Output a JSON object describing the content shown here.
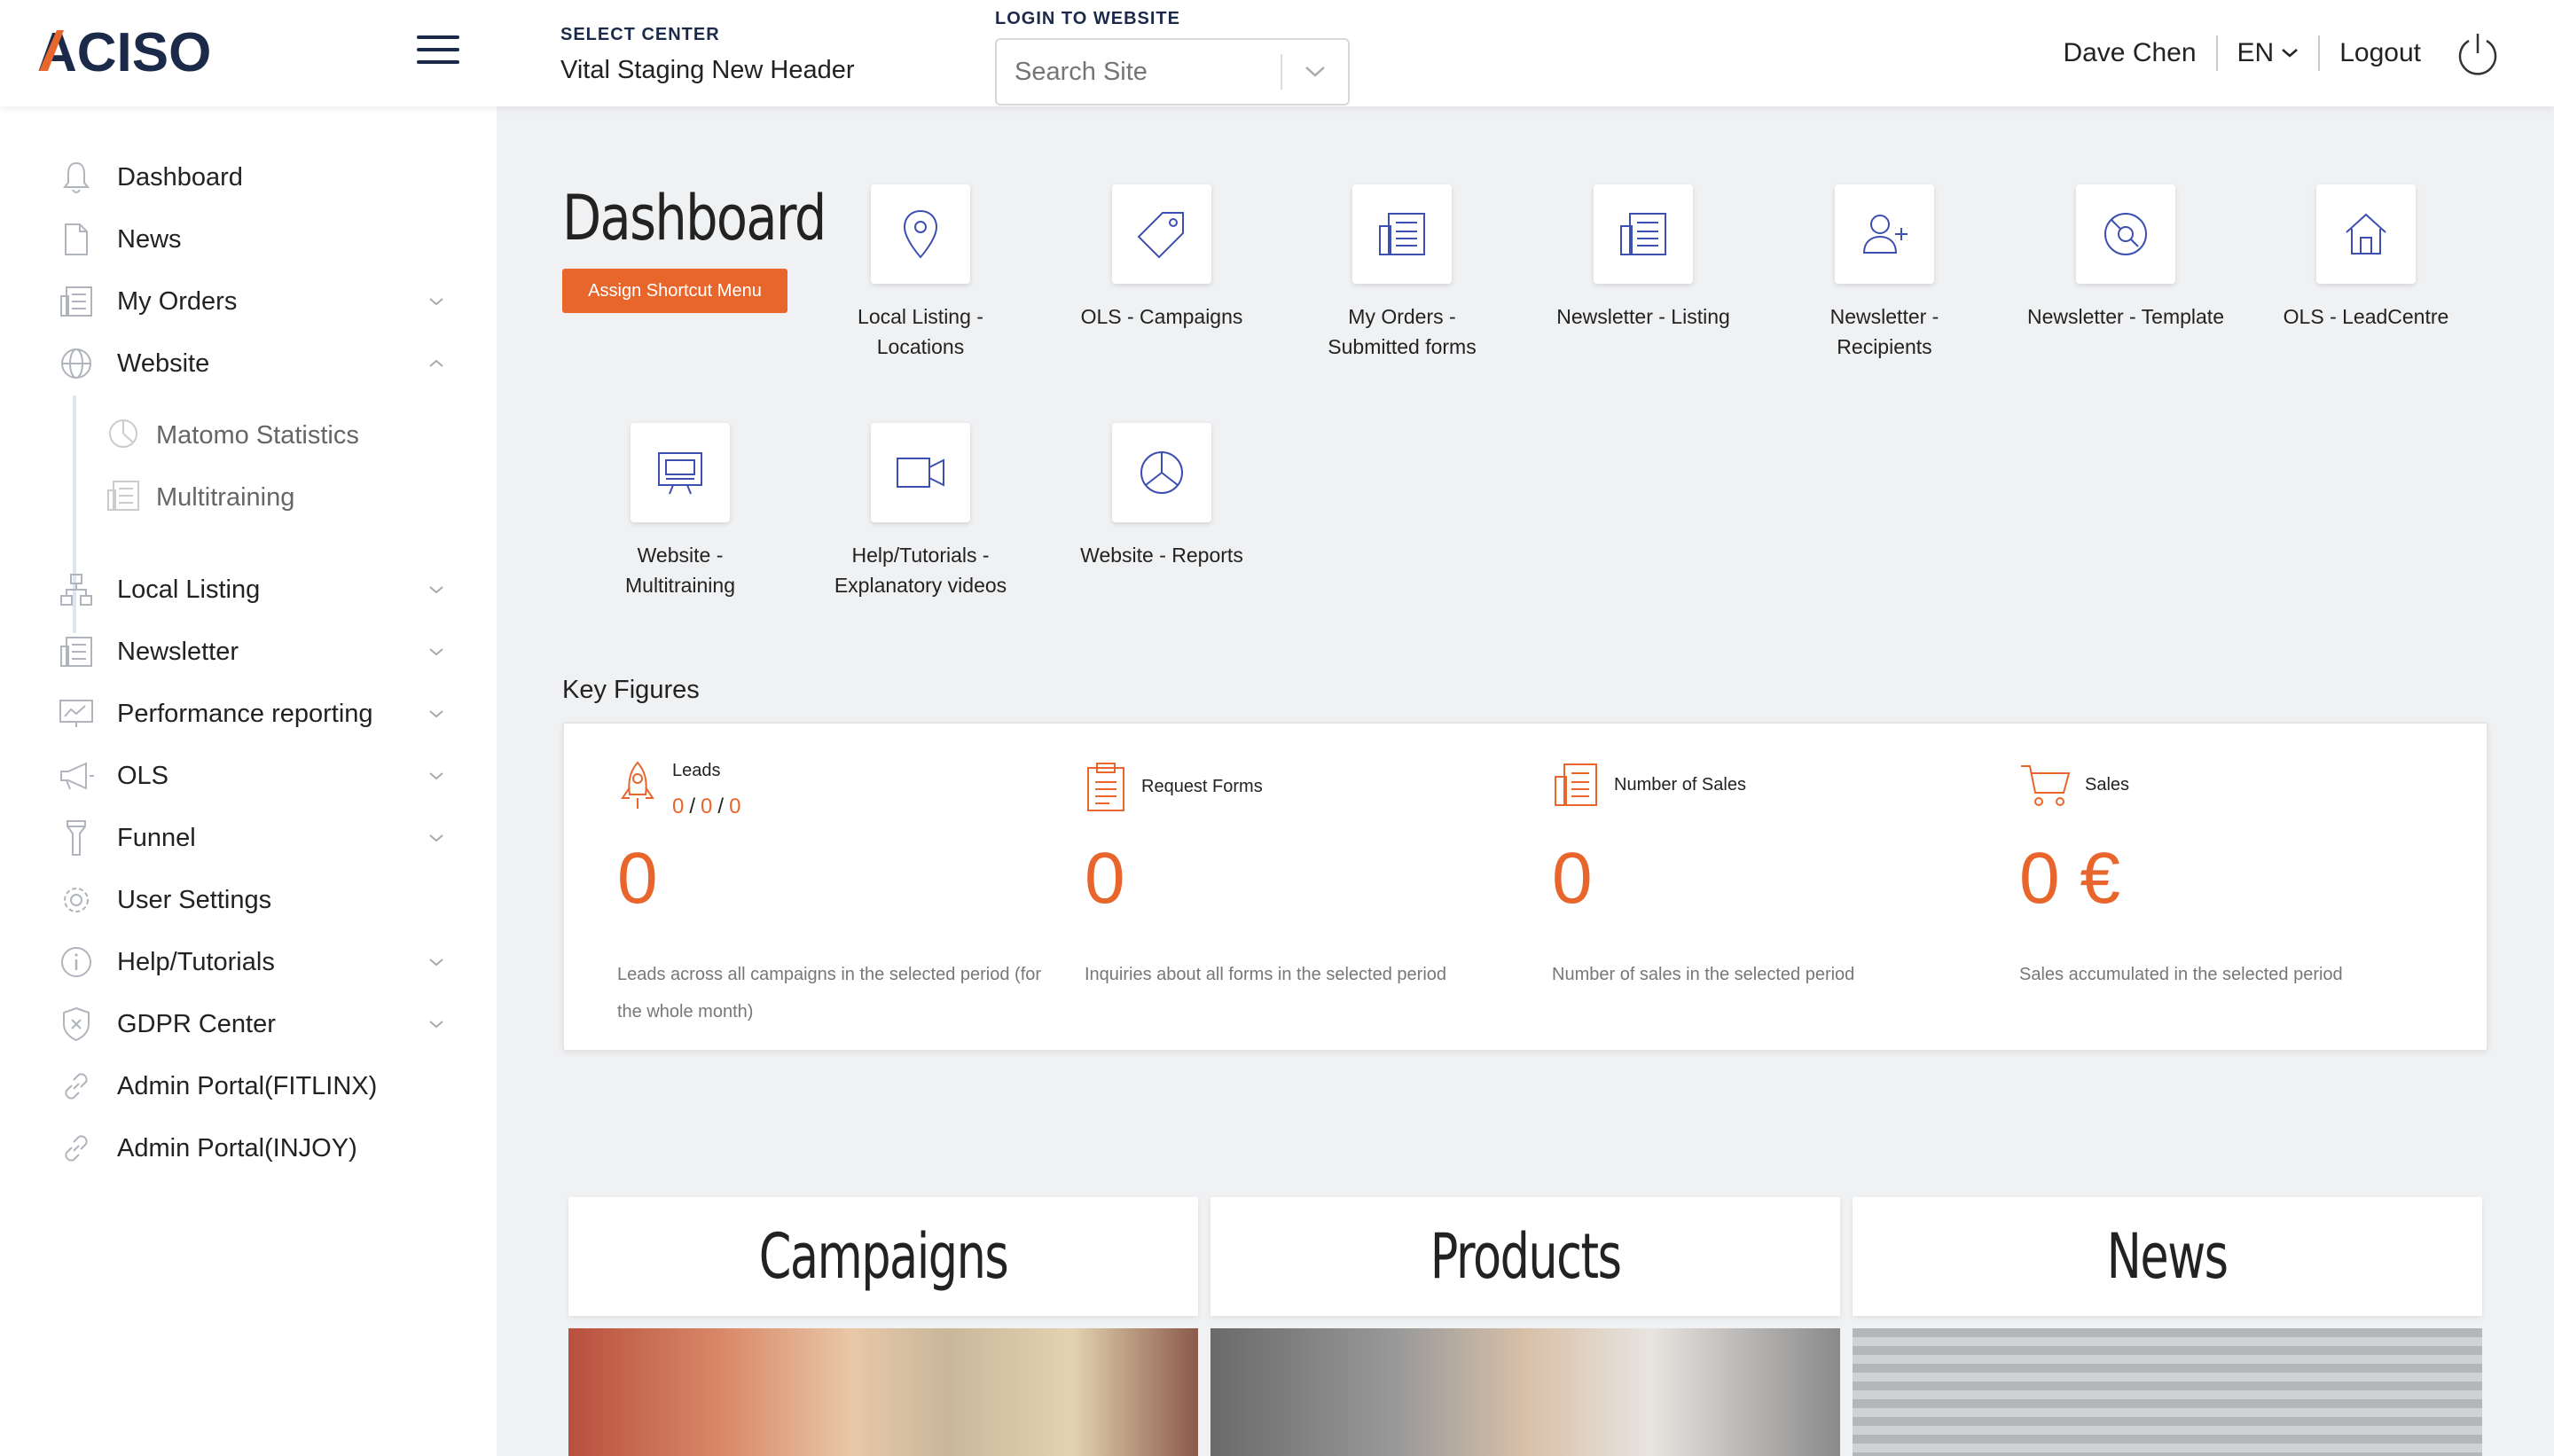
{
  "header": {
    "logo": "ACISO",
    "select_center_label": "SELECT CENTER",
    "select_center_value": "Vital Staging New Header",
    "login_label": "LOGIN TO WEBSITE",
    "search_placeholder": "Search Site",
    "user_name": "Dave Chen",
    "language": "EN",
    "logout": "Logout"
  },
  "sidebar": {
    "items": [
      {
        "label": "Dashboard",
        "icon": "bell-icon"
      },
      {
        "label": "News",
        "icon": "document-icon"
      },
      {
        "label": "My Orders",
        "icon": "newspaper-icon"
      },
      {
        "label": "Website",
        "icon": "globe-icon"
      },
      {
        "label": "Local Listing",
        "icon": "sitemap-icon"
      },
      {
        "label": "Newsletter",
        "icon": "newspaper-icon"
      },
      {
        "label": "Performance reporting",
        "icon": "presentation-icon"
      },
      {
        "label": "OLS",
        "icon": "megaphone-icon"
      },
      {
        "label": "Funnel",
        "icon": "flashlight-icon"
      },
      {
        "label": "User Settings",
        "icon": "gear-icon"
      },
      {
        "label": "Help/Tutorials",
        "icon": "info-icon"
      },
      {
        "label": "GDPR Center",
        "icon": "shield-icon"
      },
      {
        "label": "Admin Portal(FITLINX)",
        "icon": "link-icon"
      },
      {
        "label": "Admin Portal(INJOY)",
        "icon": "link-icon"
      }
    ],
    "subitems": [
      {
        "label": "Matomo Statistics",
        "icon": "pie-chart-icon"
      },
      {
        "label": "Multitraining",
        "icon": "newspaper-icon"
      }
    ]
  },
  "main": {
    "title": "Dashboard",
    "assign_button": "Assign Shortcut Menu",
    "shortcuts": [
      {
        "line1": "Local Listing -",
        "line2": "Locations",
        "icon": "map-pin-icon"
      },
      {
        "line1": "OLS - Campaigns",
        "line2": "",
        "icon": "tag-icon"
      },
      {
        "line1": "My Orders -",
        "line2": "Submitted forms",
        "icon": "newspaper-icon"
      },
      {
        "line1": "Newsletter - Listing",
        "line2": "",
        "icon": "newspaper-icon"
      },
      {
        "line1": "Newsletter -",
        "line2": "Recipients",
        "icon": "add-user-icon"
      },
      {
        "line1": "Newsletter - Template",
        "line2": "",
        "icon": "disc-icon"
      },
      {
        "line1": "OLS - LeadCentre",
        "line2": "",
        "icon": "home-icon"
      },
      {
        "line1": "Website -",
        "line2": "Multitraining",
        "icon": "presentation-icon"
      },
      {
        "line1": "Help/Tutorials -",
        "line2": "Explanatory videos",
        "icon": "video-camera-icon"
      },
      {
        "line1": "Website - Reports",
        "line2": "",
        "icon": "pie-chart-icon"
      }
    ],
    "key_figures_title": "Key Figures",
    "key_figures": [
      {
        "title": "Leads",
        "sub1": "0",
        "sub2": "0",
        "sub3": "0",
        "value": "0",
        "desc": "Leads across all campaigns in the selected period (for the whole month)"
      },
      {
        "title": "Request Forms",
        "value": "0",
        "desc": "Inquiries about all forms in the selected period"
      },
      {
        "title": "Number of Sales",
        "value": "0",
        "desc": "Number of sales in the selected period"
      },
      {
        "title": "Sales",
        "value": "0 €",
        "desc": "Sales accumulated in the selected period"
      }
    ],
    "tiles": [
      {
        "title": "Campaigns"
      },
      {
        "title": "Products"
      },
      {
        "title": "News"
      }
    ]
  },
  "colors": {
    "accent": "#e8662c",
    "brand": "#1c2a4a",
    "icon_blue": "#3d4fb0",
    "sidebar_icon": "#b0b4bd"
  }
}
